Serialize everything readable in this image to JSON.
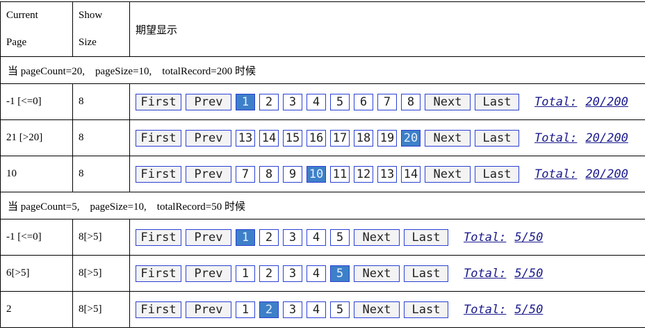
{
  "header": {
    "col1_line1": "Current",
    "col1_line2": "Page",
    "col2_line1": "Show",
    "col2_line2": "Size",
    "col3": "期望显示"
  },
  "labels": {
    "first": "First",
    "prev": "Prev",
    "next": "Next",
    "last": "Last",
    "total": "Total:"
  },
  "sections": [
    {
      "caption": "当 pageCount=20,　pageSize=10,　totalRecord=200 时候",
      "rows": [
        {
          "current": "-1 [<=0]",
          "size": "8",
          "pages": [
            "1",
            "2",
            "3",
            "4",
            "5",
            "6",
            "7",
            "8"
          ],
          "active": "1",
          "total": "20/200"
        },
        {
          "current": "21 [>20]",
          "size": "8",
          "pages": [
            "13",
            "14",
            "15",
            "16",
            "17",
            "18",
            "19",
            "20"
          ],
          "active": "20",
          "total": "20/200"
        },
        {
          "current": "10",
          "size": "8",
          "pages": [
            "7",
            "8",
            "9",
            "10",
            "11",
            "12",
            "13",
            "14"
          ],
          "active": "10",
          "total": "20/200"
        }
      ]
    },
    {
      "caption": "当 pageCount=5,　pageSize=10,　totalRecord=50 时候",
      "rows": [
        {
          "current": "-1 [<=0]",
          "size": "8[>5]",
          "pages": [
            "1",
            "2",
            "3",
            "4",
            "5"
          ],
          "active": "1",
          "total": "5/50"
        },
        {
          "current": "6[>5]",
          "size": "8[>5]",
          "pages": [
            "1",
            "2",
            "3",
            "4",
            "5"
          ],
          "active": "5",
          "total": "5/50"
        },
        {
          "current": "2",
          "size": "8[>5]",
          "pages": [
            "1",
            "2",
            "3",
            "4",
            "5"
          ],
          "active": "2",
          "total": "5/50"
        }
      ]
    }
  ]
}
